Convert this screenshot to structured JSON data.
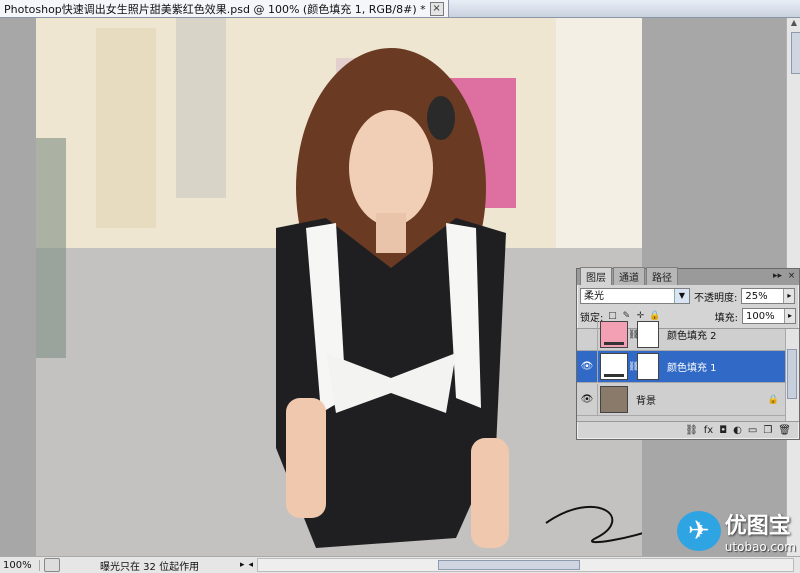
{
  "document": {
    "tab_title": "Photoshop快速调出女生照片甜美紫红色效果.psd @ 100% (颜色填充 1, RGB/8#) *",
    "close": "×"
  },
  "status": {
    "zoom": "100%",
    "message": "曝光只在 32 位起作用"
  },
  "layers_panel": {
    "tabs": [
      "图层",
      "通道",
      "路径"
    ],
    "active_tab": "图层",
    "blend_mode": "柔光",
    "opacity_label": "不透明度:",
    "opacity_value": "25%",
    "lock_label": "锁定:",
    "fill_label": "填充:",
    "fill_value": "100%",
    "layers": [
      {
        "name": "颜色填充 2",
        "visible": false,
        "thumb": "pink"
      },
      {
        "name": "颜色填充 1",
        "visible": true,
        "thumb": "white",
        "selected": true
      },
      {
        "name": "背景",
        "visible": true,
        "thumb": "photo",
        "locked": true
      }
    ],
    "bottom_icons": [
      "link-icon",
      "fx-icon",
      "mask-icon",
      "adjustment-icon",
      "group-icon",
      "new-layer-icon",
      "trash-icon"
    ]
  },
  "watermark": {
    "brand_cn": "优图宝",
    "brand_url": "utobao.com"
  },
  "colors": {
    "selection": "#3169c6",
    "fill_layer_2": "#f4a0b4",
    "logo_blue": "#2fa4e3"
  }
}
